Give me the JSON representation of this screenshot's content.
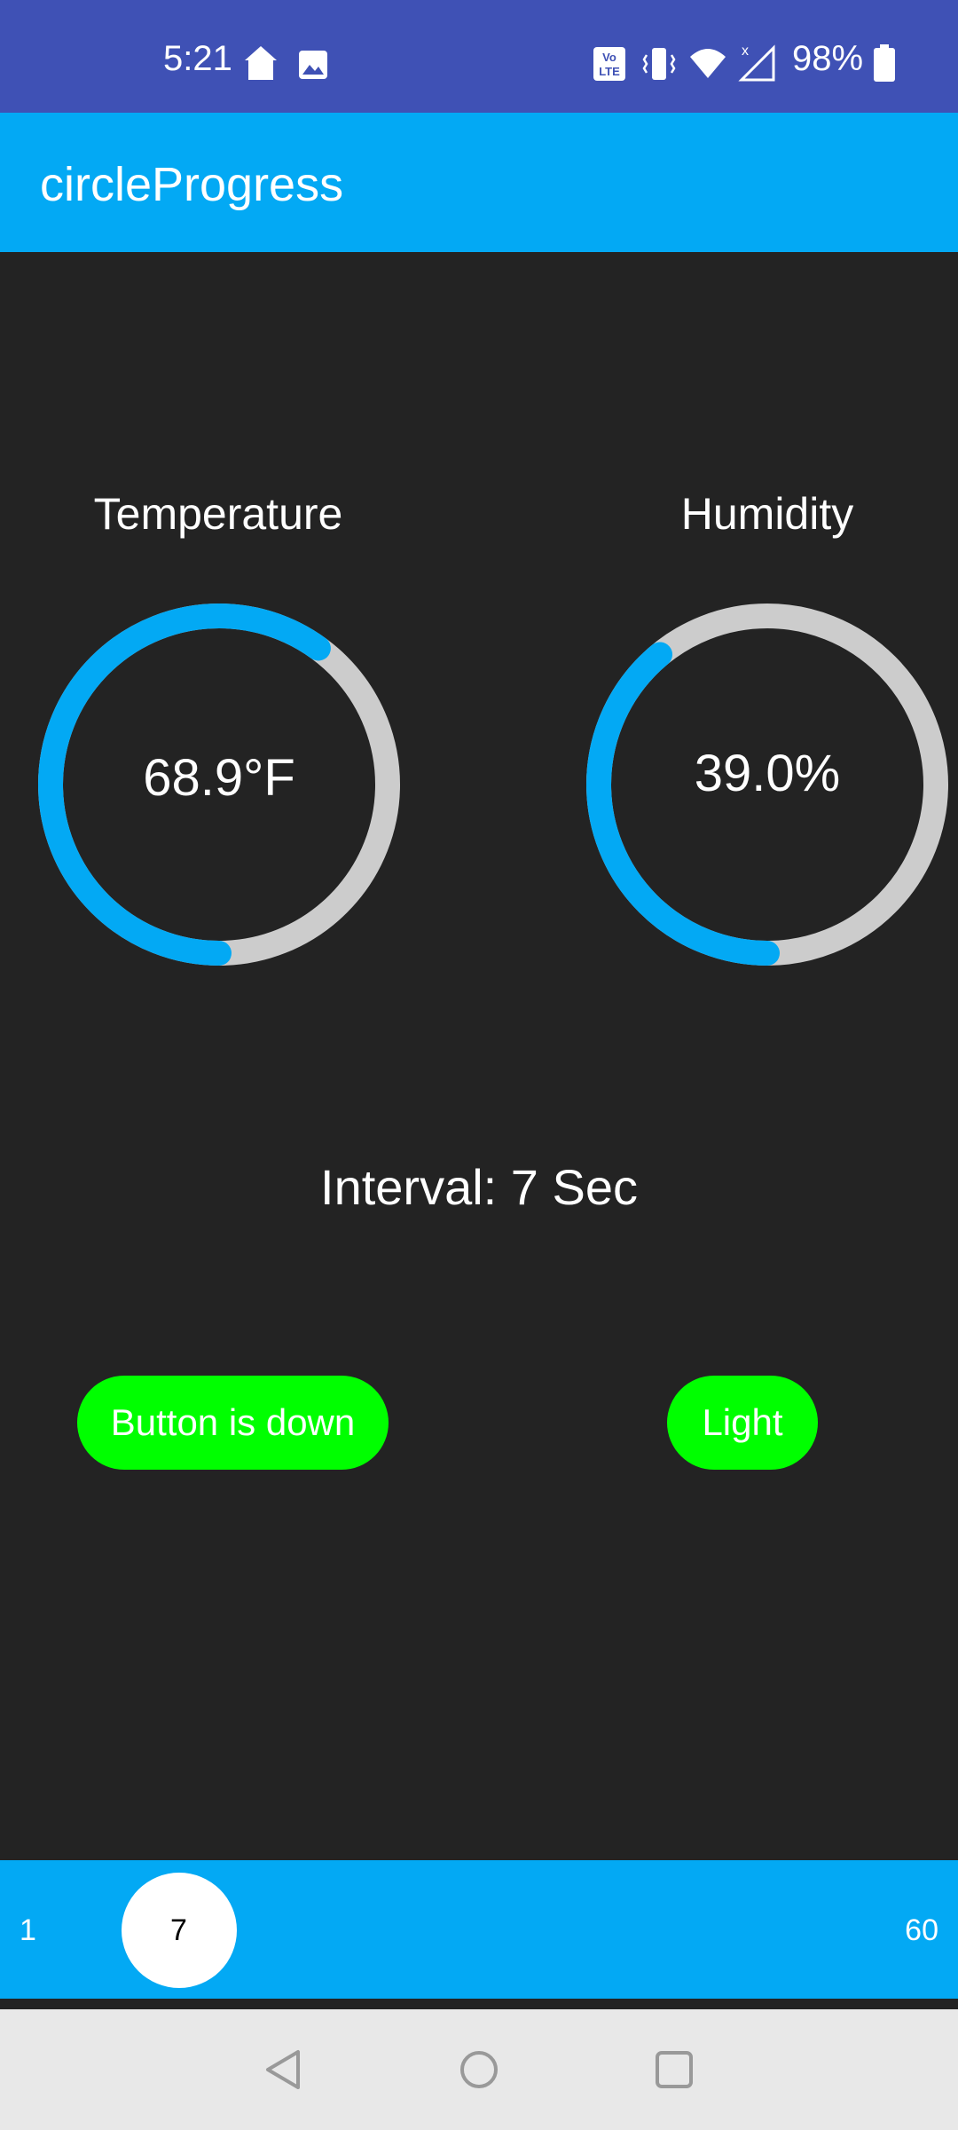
{
  "status_bar": {
    "time": "5:21",
    "battery": "98%",
    "icons": [
      "home-icon",
      "image-icon",
      "volte-icon",
      "vibrate-icon",
      "wifi-icon",
      "signal-icon",
      "battery-icon"
    ]
  },
  "app_bar": {
    "title": "circleProgress"
  },
  "gauges": {
    "temperature": {
      "label": "Temperature",
      "value": "68.9°F",
      "progress": 0.6
    },
    "humidity": {
      "label": "Humidity",
      "value": "39.0%",
      "progress": 0.39
    }
  },
  "interval": {
    "text": "Interval: 7 Sec"
  },
  "buttons": {
    "button_state": "Button is down",
    "light": "Light"
  },
  "slider": {
    "min": "1",
    "max": "60",
    "value": "7",
    "value_num": 7
  },
  "colors": {
    "status_bar": "#3F51B5",
    "accent": "#03A9F4",
    "progress_track": "#CCCCCC",
    "button": "#00FF00",
    "background": "#232323"
  }
}
